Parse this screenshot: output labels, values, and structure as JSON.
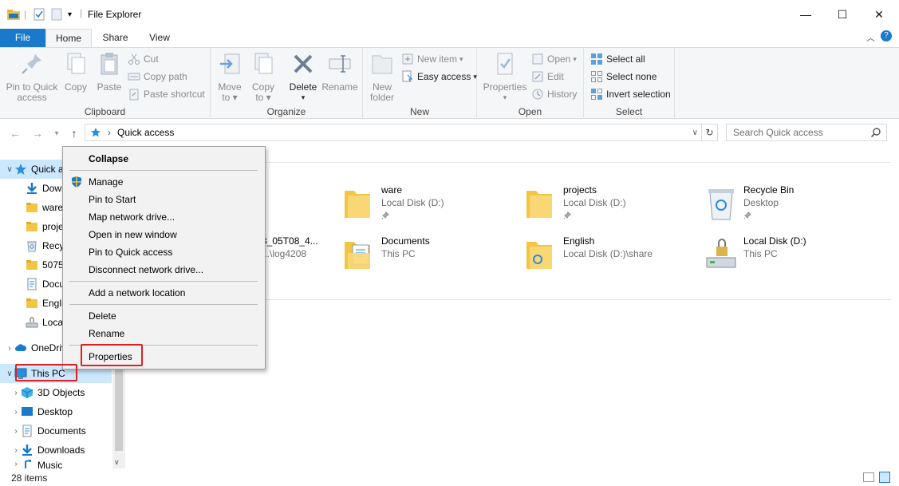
{
  "window": {
    "title": "File Explorer",
    "controls": {
      "minimize": "—",
      "maximize": "☐",
      "close": "✕"
    }
  },
  "ribbon_tabs": {
    "file": "File",
    "home": "Home",
    "share": "Share",
    "view": "View"
  },
  "ribbon": {
    "clipboard": {
      "label": "Clipboard",
      "pin_line1": "Pin to Quick",
      "pin_line2": "access",
      "copy": "Copy",
      "paste": "Paste",
      "cut": "Cut",
      "copy_path": "Copy path",
      "paste_shortcut": "Paste shortcut"
    },
    "organize": {
      "label": "Organize",
      "move_line1": "Move",
      "move_line2": "to",
      "copy_line1": "Copy",
      "copy_line2": "to",
      "delete": "Delete",
      "rename": "Rename"
    },
    "new": {
      "label": "New",
      "folder_line1": "New",
      "folder_line2": "folder",
      "new_item": "New item",
      "easy_access": "Easy access"
    },
    "open": {
      "label": "Open",
      "properties": "Properties",
      "open": "Open",
      "edit": "Edit",
      "history": "History"
    },
    "select": {
      "label": "Select",
      "select_all": "Select all",
      "select_none": "Select none",
      "invert": "Invert selection"
    }
  },
  "address": {
    "path": "Quick access",
    "search_placeholder": "Search Quick access"
  },
  "nav": {
    "items": [
      {
        "label": "Quick access",
        "icon": "star-icon"
      },
      {
        "label": "Downloads",
        "icon": "download-icon"
      },
      {
        "label": "ware",
        "icon": "folder-icon"
      },
      {
        "label": "projects",
        "icon": "folder-icon"
      },
      {
        "label": "Recycle Bin",
        "icon": "recycle-bin-icon"
      },
      {
        "label": "50758",
        "icon": "folder-icon"
      },
      {
        "label": "Documents",
        "icon": "documents-icon"
      },
      {
        "label": "English",
        "icon": "folder-icon"
      },
      {
        "label": "Local Disk (D:)",
        "icon": "drive-icon"
      },
      {
        "label": "OneDrive",
        "icon": "cloud-icon"
      },
      {
        "label": "This PC",
        "icon": "computer-icon"
      },
      {
        "label": "3D Objects",
        "icon": "cube-icon"
      },
      {
        "label": "Desktop",
        "icon": "desktop-icon"
      },
      {
        "label": "Documents",
        "icon": "documents-icon"
      },
      {
        "label": "Downloads",
        "icon": "download-icon"
      },
      {
        "label": "Music",
        "icon": "music-icon"
      }
    ]
  },
  "content": {
    "items": [
      {
        "name": "ware",
        "sub": "Local Disk (D:)",
        "pinned": true
      },
      {
        "name": "projects",
        "sub": "Local Disk (D:)",
        "pinned": true
      },
      {
        "name": "Recycle Bin",
        "sub": "Desktop",
        "pinned": true
      },
      {
        "name": "3_05T08_4...",
        "sub": "...\\log4208"
      },
      {
        "name": "Documents",
        "sub": "This PC"
      },
      {
        "name": "English",
        "sub": "Local Disk (D:)\\share"
      },
      {
        "name": "Local Disk (D:)",
        "sub": "This PC"
      }
    ]
  },
  "context_menu": {
    "collapse": "Collapse",
    "manage": "Manage",
    "pin_start": "Pin to Start",
    "map_drive": "Map network drive...",
    "open_new_window": "Open in new window",
    "pin_quick": "Pin to Quick access",
    "disconnect": "Disconnect network drive...",
    "add_location": "Add a network location",
    "delete": "Delete",
    "rename": "Rename",
    "properties": "Properties"
  },
  "status": {
    "count": "28 items"
  },
  "colors": {
    "accent": "#1979ca",
    "highlight_box": "#e02020",
    "folder": "#f4c542"
  }
}
